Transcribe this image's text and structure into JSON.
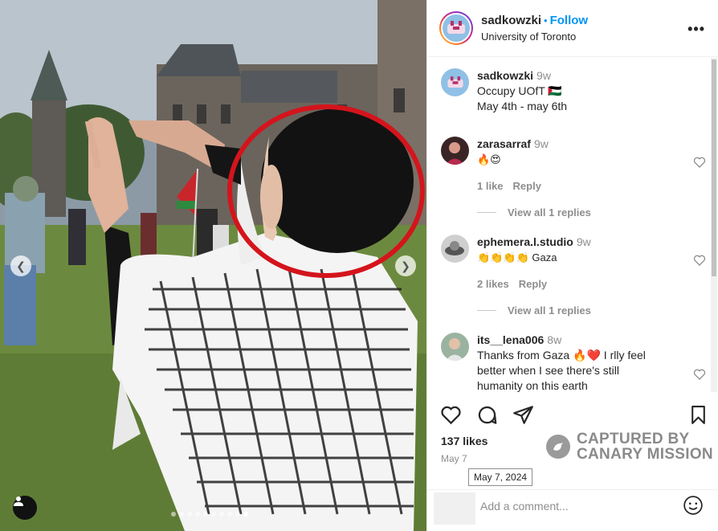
{
  "header": {
    "username": "sadkowzki",
    "separator": "•",
    "follow_label": "Follow",
    "location": "University of Toronto",
    "more_label": "•••"
  },
  "caption": {
    "username": "sadkowzki",
    "time": "9w",
    "line1": "Occupy UOfT 🇵🇸",
    "line2": "May 4th - may 6th"
  },
  "comments": [
    {
      "username": "zarasarraf",
      "time": "9w",
      "text": "🔥😍",
      "likes": "1 like",
      "reply": "Reply",
      "view_replies": "View all 1 replies"
    },
    {
      "username": "ephemera.l.studio",
      "time": "9w",
      "text": "👏👏👏👏 Gaza",
      "likes": "2 likes",
      "reply": "Reply",
      "view_replies": "View all 1 replies"
    },
    {
      "username": "its__lena006",
      "time": "8w",
      "text_a": "Thanks from Gaza 🔥❤️ I rlly feel",
      "text_b": "better when I see there's still",
      "text_c": "humanity on this earth"
    }
  ],
  "footer": {
    "likes": "137 likes",
    "date": "May 7",
    "tooltip": "May 7, 2024",
    "add_comment_placeholder": "Add a comment..."
  },
  "watermark": {
    "line1": "CAPTURED BY",
    "line2": "CANARY MISSION"
  },
  "carousel": {
    "slide_count": 10,
    "active_index": 9
  },
  "colors": {
    "accent": "#0095f6",
    "highlight_circle": "#d4141c"
  }
}
